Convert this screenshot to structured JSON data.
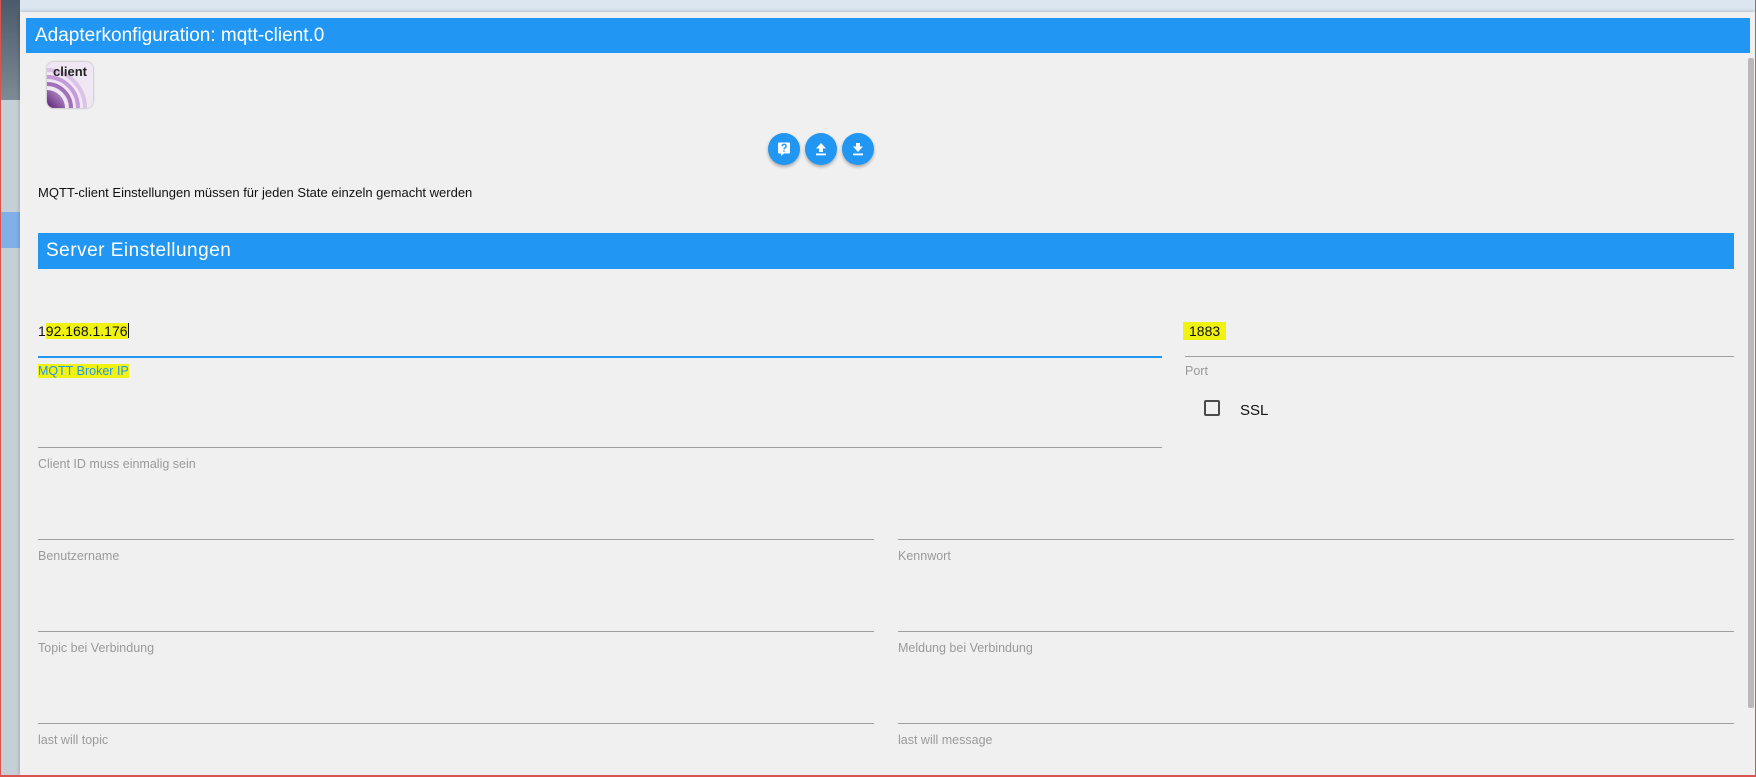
{
  "window": {
    "title": "Adapterkonfiguration: mqtt-client.0"
  },
  "logo": {
    "text": "client",
    "icon": "mqtt-client-logo"
  },
  "toolbar": {
    "buttons": [
      {
        "icon": "help-icon"
      },
      {
        "icon": "upload-icon"
      },
      {
        "icon": "download-icon"
      }
    ]
  },
  "info_text": "MQTT-client Einstellungen müssen für jeden State einzeln gemacht werden",
  "section": {
    "title": "Server Einstellungen"
  },
  "fields": {
    "broker_ip": {
      "value_prefix": "1",
      "value_highlight": "92.168.1.176",
      "label": "MQTT Broker IP"
    },
    "port": {
      "value": "1883",
      "label": "Port"
    },
    "ssl": {
      "label": "SSL",
      "checked": false
    },
    "client_id": {
      "value": "",
      "label": "Client ID muss einmalig sein"
    },
    "username": {
      "value": "",
      "label": "Benutzername"
    },
    "password": {
      "value": "",
      "label": "Kennwort"
    },
    "connect_topic": {
      "value": "",
      "label": "Topic bei Verbindung"
    },
    "connect_message": {
      "value": "",
      "label": "Meldung bei Verbindung"
    },
    "last_will_topic": {
      "value": "",
      "label": "last will topic"
    },
    "last_will_message": {
      "value": "",
      "label": "last will message"
    }
  },
  "colors": {
    "accent": "#2196f3",
    "highlight": "#f0f20f",
    "background": "#f0f0f0"
  }
}
